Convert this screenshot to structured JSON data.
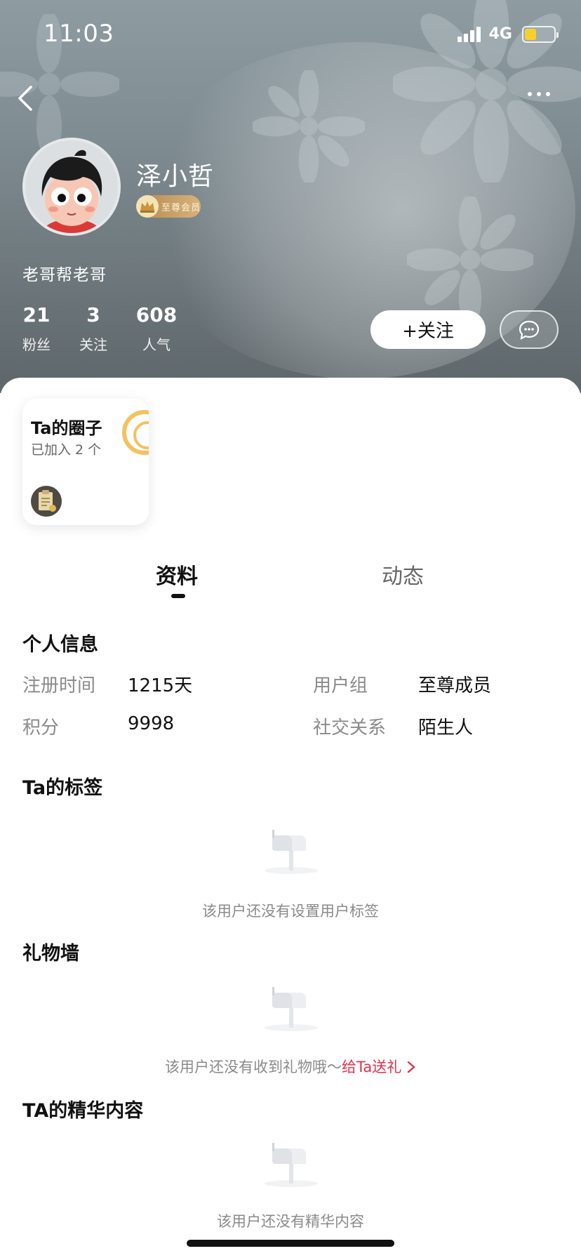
{
  "status_bar": {
    "time": "11:03",
    "network": "4G",
    "battery_color": "#f7d02c"
  },
  "header": {
    "nickname": "泽小哲",
    "vip_badge_text": "至尊会员",
    "signature": "老哥帮老哥",
    "stats": [
      {
        "value": "21",
        "label": "粉丝"
      },
      {
        "value": "3",
        "label": "关注"
      },
      {
        "value": "608",
        "label": "人气"
      }
    ],
    "follow_label": "+关注"
  },
  "circle_card": {
    "title": "Ta的圈子",
    "subtitle": "已加入 2 个",
    "accent_color": "#f2c260"
  },
  "tabs": [
    {
      "label": "资料",
      "active": true
    },
    {
      "label": "动态",
      "active": false
    }
  ],
  "personal_info": {
    "title": "个人信息",
    "rows": [
      {
        "left_label": "注册时间",
        "left_value": "1215天",
        "right_label": "用户组",
        "right_value": "至尊成员"
      },
      {
        "left_label": "积分",
        "left_value": "9998",
        "right_label": "社交关系",
        "right_value": "陌生人"
      }
    ]
  },
  "tags_section": {
    "title": "Ta的标签",
    "empty_text": "该用户还没有设置用户标签"
  },
  "gift_section": {
    "title": "礼物墙",
    "empty_text": "该用户还没有收到礼物哦～",
    "link_text": "给Ta送礼",
    "link_color": "#e2304a"
  },
  "essence_section": {
    "title": "TA的精华内容",
    "empty_text": "该用户还没有精华内容"
  }
}
